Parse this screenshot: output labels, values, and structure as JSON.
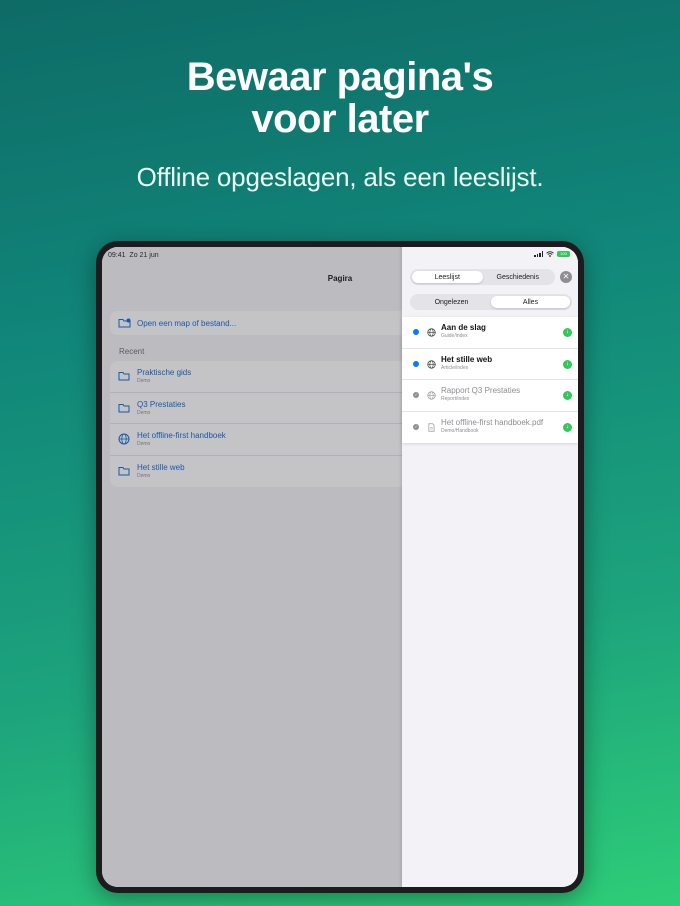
{
  "promo": {
    "headline_line1": "Bewaar pagina's",
    "headline_line2": "voor later",
    "subheadline": "Offline opgeslagen, als een leeslijst."
  },
  "status_bar": {
    "time": "09:41",
    "date": "Zo 21 jun",
    "battery": "100"
  },
  "left_app": {
    "nav_title": "Pagira",
    "open_label": "Open een map of bestand...",
    "recent_header": "Recent",
    "recent": [
      {
        "title": "Praktische gids",
        "subtitle": "Demo",
        "icon": "folder-icon"
      },
      {
        "title": "Q3 Prestaties",
        "subtitle": "Demo",
        "icon": "folder-icon"
      },
      {
        "title": "Het offline-first handboek",
        "subtitle": "Demo",
        "icon": "globe-icon"
      },
      {
        "title": "Het stille web",
        "subtitle": "Demo",
        "icon": "folder-icon"
      }
    ]
  },
  "panel": {
    "tabs": [
      "Leeslijst",
      "Geschiedenis"
    ],
    "active_tab": "Leeslijst",
    "filters": [
      "Ongelezen",
      "Alles"
    ],
    "active_filter": "Alles",
    "close_label": "✕",
    "items": [
      {
        "title": "Aan de slag",
        "subtitle": "Guide/index",
        "icon": "globe-icon",
        "state": "unread"
      },
      {
        "title": "Het stille web",
        "subtitle": "Article/index",
        "icon": "globe-icon",
        "state": "unread"
      },
      {
        "title": "Rapport Q3 Prestaties",
        "subtitle": "Report/index",
        "icon": "globe-icon",
        "state": "read"
      },
      {
        "title": "Het offline-first handboek.pdf",
        "subtitle": "Demo/Handbook",
        "icon": "document-icon",
        "state": "read"
      }
    ]
  },
  "colors": {
    "accent": "#0a64d6",
    "unread_dot": "#0a7aff",
    "download": "#34c759"
  }
}
